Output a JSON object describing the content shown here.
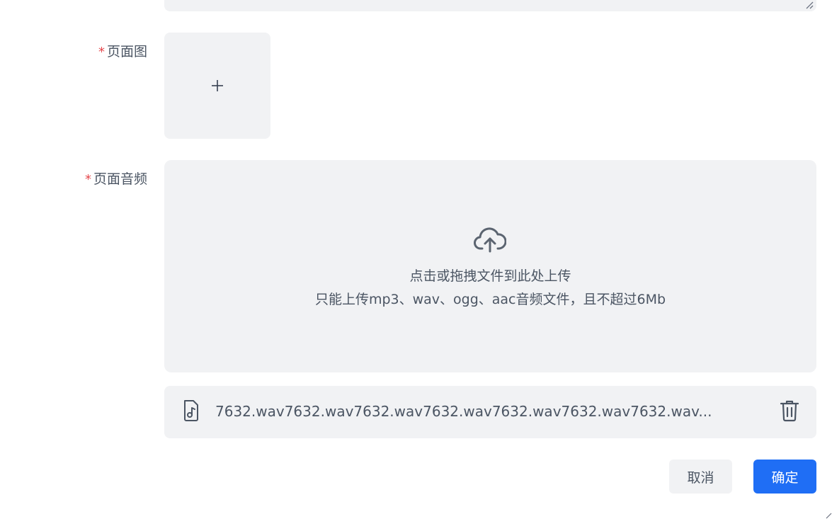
{
  "form": {
    "page_image": {
      "required_mark": "*",
      "label": "页面图",
      "add_icon": "plus-icon"
    },
    "page_audio": {
      "required_mark": "*",
      "label": "页面音频",
      "upload_icon": "cloud-upload-icon",
      "drop_text": "点击或拖拽文件到此处上传",
      "hint_text": "只能上传mp3、wav、ogg、aac音频文件，且不超过6Mb",
      "file": {
        "icon": "music-file-icon",
        "name": "7632.wav7632.wav7632.wav7632.wav7632.wav7632.wav7632.wav...",
        "delete_icon": "trash-icon"
      }
    }
  },
  "footer": {
    "cancel_label": "取消",
    "confirm_label": "确定"
  },
  "colors": {
    "primary": "#1f6ef5",
    "required": "#e5484d",
    "surface": "#f1f2f4",
    "text": "#4b5563"
  }
}
